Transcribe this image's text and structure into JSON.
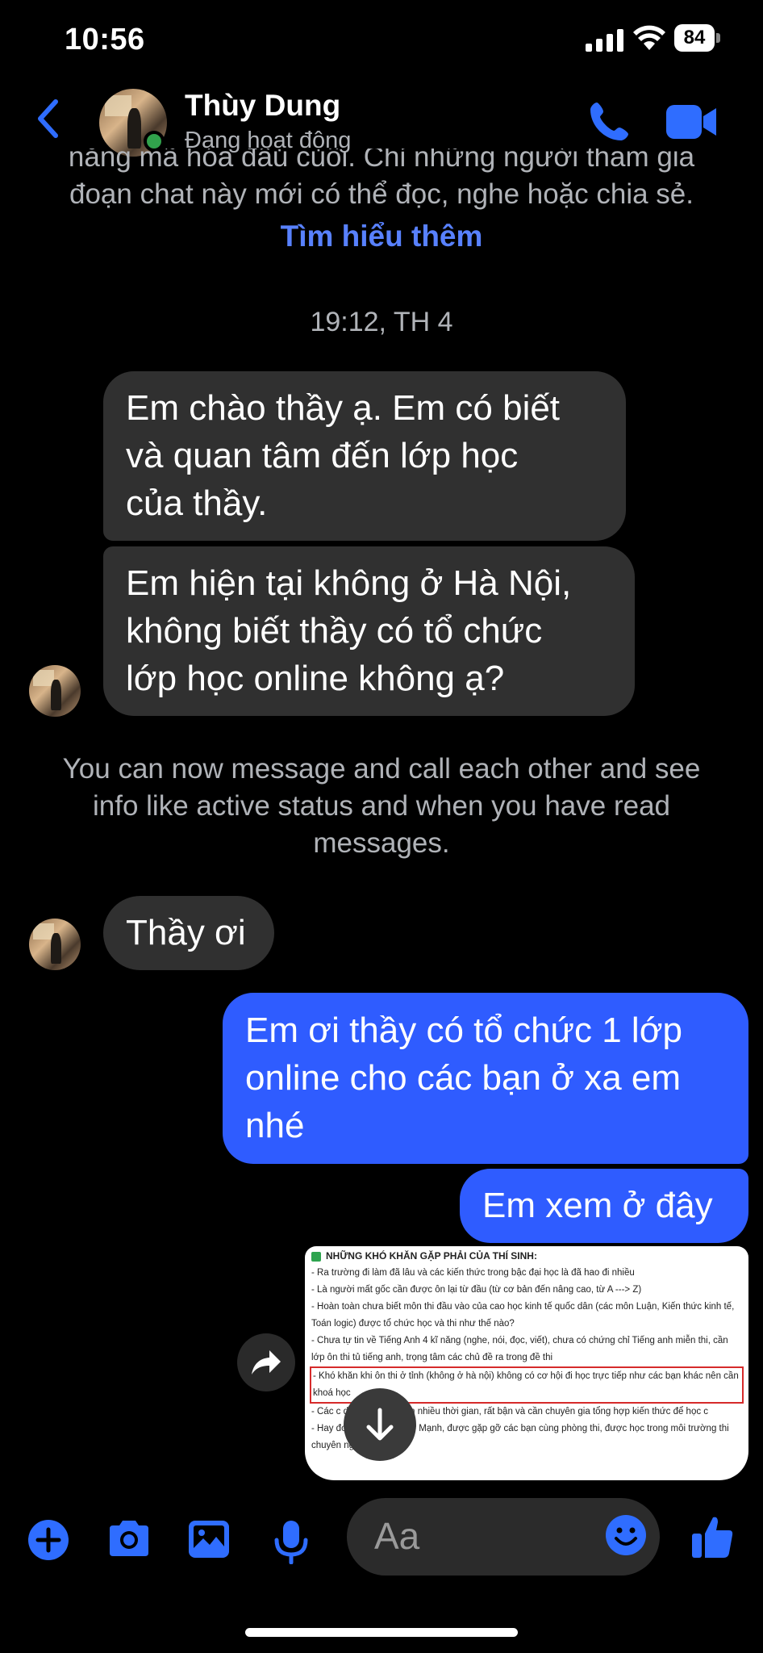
{
  "status_bar": {
    "time": "10:56",
    "battery": "84"
  },
  "header": {
    "contact_name": "Thùy Dung",
    "contact_status": "Đang hoạt động",
    "accent": "#2f6dff",
    "online_color": "#31a24c"
  },
  "encryption_notice": {
    "lines": [
      "năng mã hóa đầu cuối. Chỉ những người tham gia",
      "đoạn chat này mới có thể đọc, nghe hoặc chia sẻ."
    ],
    "link": "Tìm hiểu thêm"
  },
  "timestamp": "19:12, TH 4",
  "messages": [
    {
      "from": "contact",
      "lines": [
        "Em chào thầy ạ. Em có biết",
        "và quan tâm đến lớp học",
        "của thầy."
      ]
    },
    {
      "from": "contact",
      "lines": [
        "Em hiện tại không ở Hà Nội,",
        "không biết thầy có tổ chức",
        "lớp học online không ạ?"
      ]
    },
    {
      "from": "contact",
      "lines": [
        "Thầy ơi"
      ]
    },
    {
      "from": "me",
      "lines": [
        "Em ơi thầy có tổ chức 1 lớp",
        "online cho các bạn ở xa em",
        "nhé"
      ]
    },
    {
      "from": "me",
      "lines": [
        "Em xem ở đây"
      ]
    }
  ],
  "system_note": {
    "lines": [
      "You can now message and call each other and see",
      "info like active status and when you have read",
      "messages."
    ]
  },
  "attachment": {
    "title": "NHỮNG KHÓ KHĂN GẶP PHẢI CỦA THÍ SINH:",
    "lines": [
      "- Ra trường đi làm đã lâu và các kiến thức trong bậc đại học là đã hao đi nhiều",
      "- Là người mất gốc cần được ôn lại từ đầu (từ cơ bản đến nâng cao, từ A ---> Z)",
      "- Hoàn toàn chưa biết môn thi đầu vào của cao học kinh tế quốc dân (các môn Luận, Kiến thức kinh tế, Toán logic) được tổ chức học và thi như thế nào?",
      "- Chưa tự tin về Tiếng Anh 4 kĩ năng (nghe, nói, đọc, viết), chưa có chứng chỉ Tiếng anh miễn thi, cần lớp ôn thi tủ tiếng anh, trọng tâm các chủ đề ra trong đề thi"
    ],
    "highlighted": "- Khó khăn khi ôn thi ở tỉnh (không ở hà nội) không có cơ hội đi học trực tiếp như các bạn khác nên cần khoá học",
    "lines_after": [
      "- Các c                  doanh nghiệp tốn nhiều thời gian, rất bận và cần chuyên gia tổng hợp kiến thức để học c",
      "- Hay đơn giả           n gặp Thầy Mạnh, được gặp gỡ các bạn cùng phòng thi, được học trong môi trường thi chuyên nghiệp."
    ]
  },
  "composer": {
    "placeholder": "Aa"
  }
}
